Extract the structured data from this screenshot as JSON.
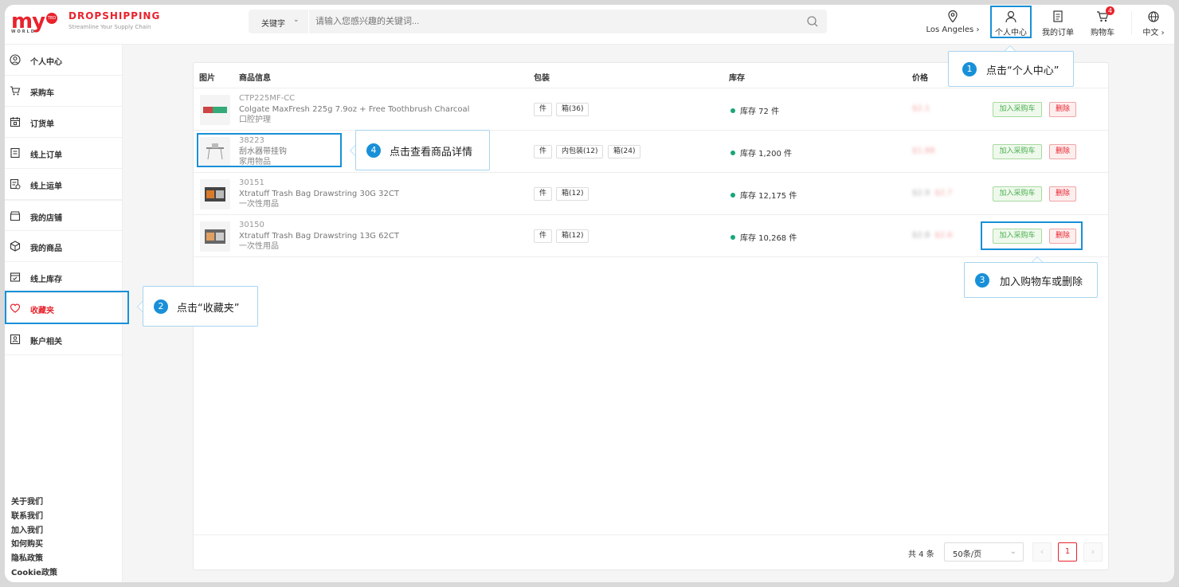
{
  "logo": {
    "text": "my",
    "badge": "TBD",
    "sub": "WORLD"
  },
  "brand": {
    "title": "DROPSHIPPING",
    "subtitle": "Streamline Your Supply Chain"
  },
  "search": {
    "keyword_label": "关键字",
    "placeholder": "请输入您感兴趣的关键词..."
  },
  "header_nav": {
    "location": "Los Angeles",
    "personal_center": "个人中心",
    "my_orders": "我的订单",
    "cart": "购物车",
    "cart_count": "4",
    "language": "中文"
  },
  "sidebar": {
    "items": [
      {
        "label": "个人中心",
        "icon": "user-circle-icon"
      },
      {
        "label": "采购车",
        "icon": "cart-icon"
      },
      {
        "label": "订货单",
        "icon": "calendar-icon"
      },
      {
        "label": "线上订单",
        "icon": "document-icon"
      },
      {
        "label": "线上运单",
        "icon": "waybill-icon"
      },
      {
        "label": "我的店铺",
        "icon": "store-icon"
      },
      {
        "label": "我的商品",
        "icon": "box-icon"
      },
      {
        "label": "线上库存",
        "icon": "inventory-icon"
      },
      {
        "label": "收藏夹",
        "icon": "heart-icon"
      },
      {
        "label": "账户相关",
        "icon": "account-icon"
      }
    ],
    "footer": [
      "关于我们",
      "联系我们",
      "加入我们",
      "如何购买",
      "隐私政策",
      "Cookie政策"
    ]
  },
  "table": {
    "headers": {
      "image": "图片",
      "info": "商品信息",
      "package": "包装",
      "stock": "库存",
      "price": "价格"
    },
    "rows": [
      {
        "sku": "CTP225MF-CC",
        "name": "Colgate MaxFresh 225g 7.9oz + Free Toothbrush Charcoal",
        "category": "口腔护理",
        "packages": [
          "件",
          "箱(36)"
        ],
        "stock": "库存 72 件",
        "old_price": "",
        "price": "$2.1"
      },
      {
        "sku": "38223",
        "name": "刮水器带挂钩",
        "category": "家用物品",
        "packages": [
          "件",
          "内包装(12)",
          "箱(24)"
        ],
        "stock": "库存 1,200 件",
        "old_price": "",
        "price": "$1.88"
      },
      {
        "sku": "30151",
        "name": "Xtratuff Trash Bag Drawstring 30G 32CT",
        "category": "一次性用品",
        "packages": [
          "件",
          "箱(12)"
        ],
        "stock": "库存 12,175 件",
        "old_price": "$2.9",
        "price": "$2.7"
      },
      {
        "sku": "30150",
        "name": "Xtratuff Trash Bag Drawstring 13G 62CT",
        "category": "一次性用品",
        "packages": [
          "件",
          "箱(12)"
        ],
        "stock": "库存 10,268 件",
        "old_price": "$2.8",
        "price": "$2.6"
      }
    ],
    "add_label": "加入采购车",
    "delete_label": "删除"
  },
  "pager": {
    "total": "共 4 条",
    "page_size": "50条/页",
    "current": "1",
    "prev": "‹",
    "next": "›"
  },
  "callouts": {
    "c1": {
      "num": "1",
      "text": "点击“个人中心”"
    },
    "c2": {
      "num": "2",
      "text": "点击“收藏夹”"
    },
    "c3": {
      "num": "3",
      "text": "加入购物车或删除"
    },
    "c4": {
      "num": "4",
      "text": "点击查看商品详情"
    }
  },
  "colors": {
    "brand": "#e8232d",
    "highlight": "#1890d8",
    "stock_dot": "#19a67a"
  }
}
